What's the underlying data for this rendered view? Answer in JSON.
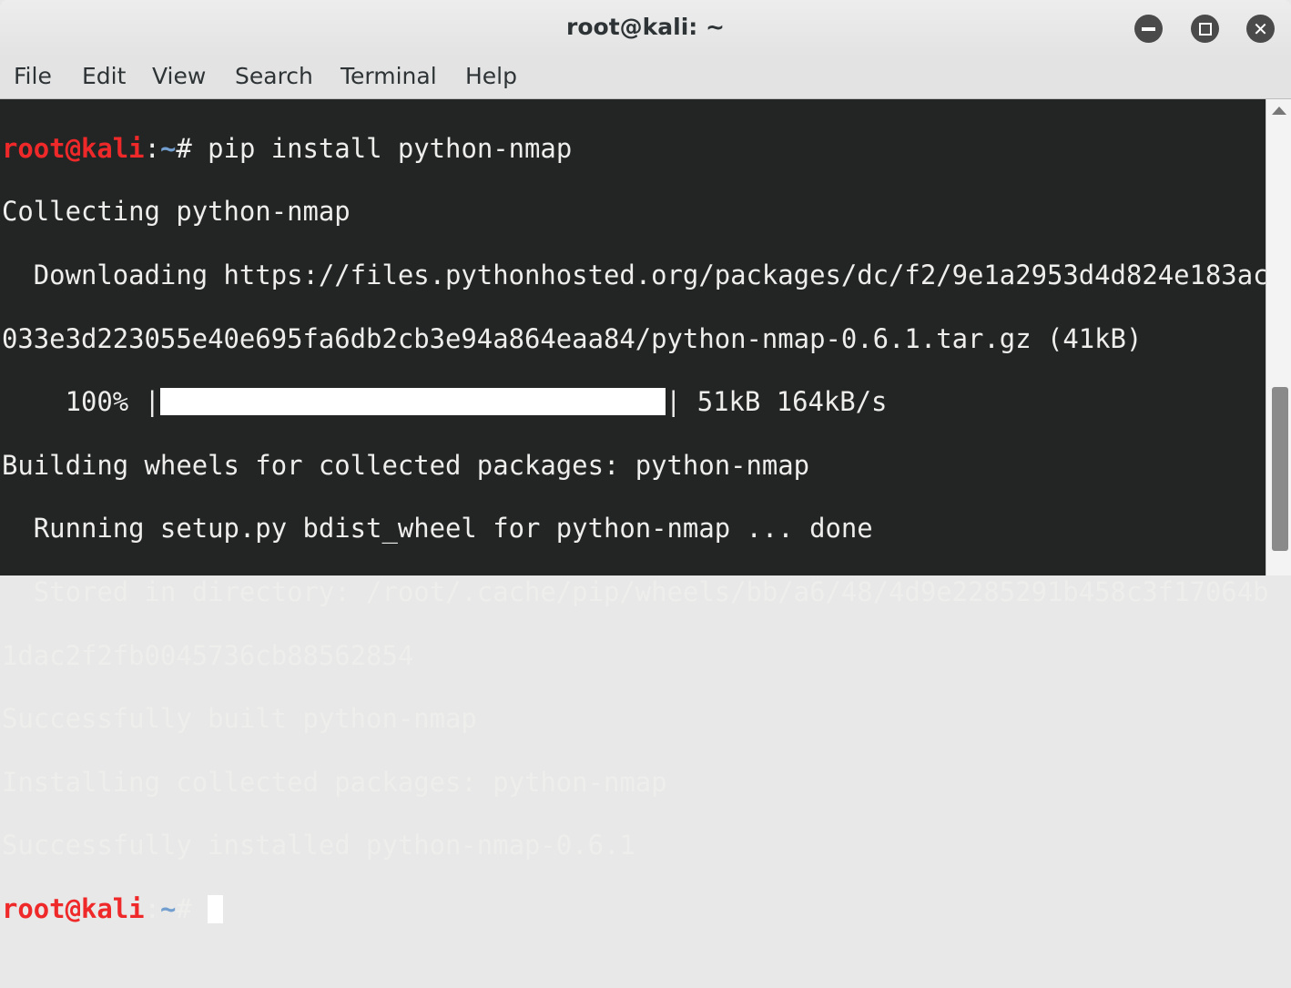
{
  "window": {
    "title": "root@kali: ~"
  },
  "menu": [
    "File",
    "Edit",
    "View",
    "Search",
    "Terminal",
    "Help"
  ],
  "prompt": {
    "user_host": "root@kali",
    "sep": ":",
    "path": "~",
    "symbol": "# "
  },
  "terminal": {
    "command": "pip install python-nmap",
    "lines": [
      "Collecting python-nmap",
      "  Downloading https://files.pythonhosted.org/packages/dc/f2/9e1a2953d4d824e183ac",
      "033e3d223055e40e695fa6db2cb3e94a864eaa84/python-nmap-0.6.1.tar.gz (41kB)"
    ],
    "progress": {
      "prefix": "    100% |",
      "suffix": "| 51kB 164kB/s",
      "percent": 100
    },
    "lines2": [
      "Building wheels for collected packages: python-nmap",
      "  Running setup.py bdist_wheel for python-nmap ... done",
      "  Stored in directory: /root/.cache/pip/wheels/bb/a6/48/4d9e2285291b458c3f17064b",
      "1dac2f2fb0045736cb88562854",
      "Successfully built python-nmap",
      "Installing collected packages: python-nmap",
      "Successfully installed python-nmap-0.6.1"
    ]
  },
  "colors": {
    "prompt_user": "#ef2929",
    "prompt_path": "#729fcf",
    "background": "#232525"
  }
}
